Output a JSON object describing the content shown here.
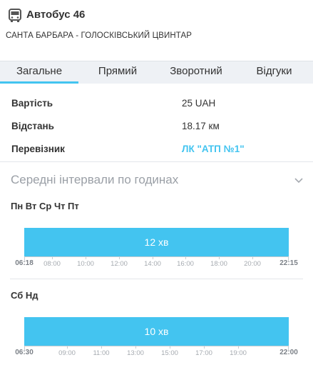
{
  "route": {
    "icon": "bus-icon",
    "title": "Автобус 46",
    "subtitle": "САНТА БАРБАРА - ГОЛОСКІВСЬКИЙ ЦВИНТАР"
  },
  "tabs": [
    {
      "label": "Загальне",
      "active": true
    },
    {
      "label": "Прямий",
      "active": false
    },
    {
      "label": "Зворотний",
      "active": false
    },
    {
      "label": "Відгуки",
      "active": false
    }
  ],
  "info": {
    "price_label": "Вартість",
    "price_value": "25 UAH",
    "distance_label": "Відстань",
    "distance_value": "18.17 км",
    "carrier_label": "Перевізник",
    "carrier_value": "ЛК \"АТП №1\""
  },
  "intervals": {
    "title": "Середні інтервали по годинах",
    "icon": "chevron-down-icon",
    "weekdays": {
      "label": "Пн Вт Ср Чт Пт",
      "interval": "12 хв",
      "start": "06:18",
      "end": "22:15",
      "ticks": [
        "08:00",
        "10:00",
        "12:00",
        "14:00",
        "16:00",
        "18:00",
        "20:00"
      ]
    },
    "weekend": {
      "label": "Сб Нд",
      "interval": "10 хв",
      "start": "06:30",
      "end": "22:00",
      "ticks": [
        "09:00",
        "11:00",
        "13:00",
        "15:00",
        "17:00",
        "19:00"
      ]
    }
  },
  "colors": {
    "accent": "#43c4f0",
    "tab_bg": "#eef1f5",
    "muted_text": "#9a9fa6"
  }
}
